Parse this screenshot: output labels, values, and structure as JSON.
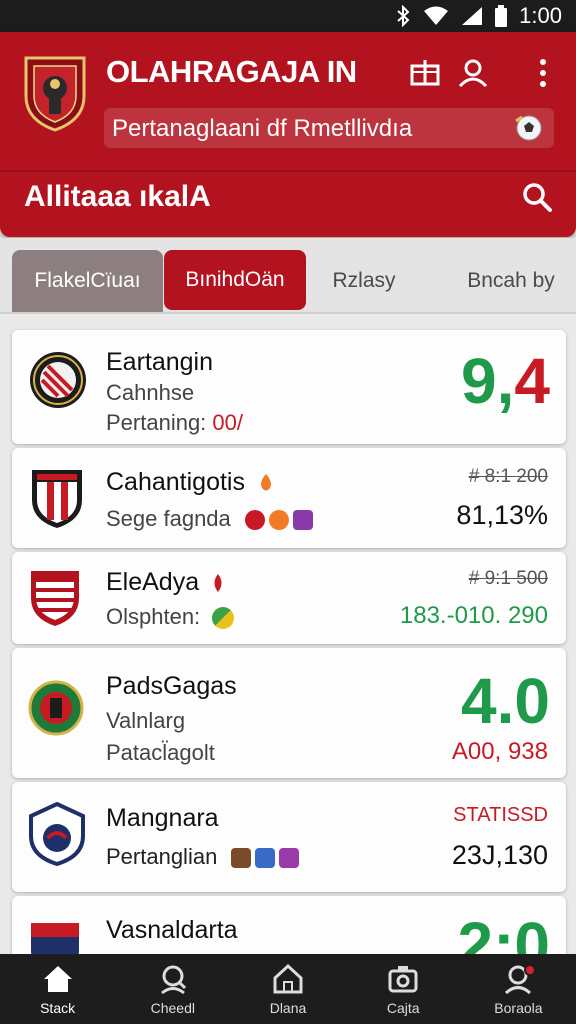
{
  "status_bar": {
    "time": "1:00"
  },
  "header": {
    "title": "OLAHRAGAJA IN",
    "subtitle": "Pertanaglaani df Rmetllivdıa",
    "section_title": "Allitaaa ıkalA"
  },
  "tabs": [
    {
      "label": "FlakelCïuaı"
    },
    {
      "label": "BınihdOän"
    },
    {
      "label": "Rzlasy"
    },
    {
      "label": "Bncah by"
    }
  ],
  "items": [
    {
      "name": "Eartangin",
      "line2": "Cahnhse",
      "line3_label": "Pertaning:",
      "line3_value": "00/",
      "value": "9,4",
      "value_colors": [
        "#1f9a4a",
        "#c81a24"
      ]
    },
    {
      "name": "Cahantigotis",
      "line2": "Sege fagnda",
      "old_value": "# 8:1 200",
      "value": "81,13%"
    },
    {
      "name": "EleAdya",
      "line2": "Olsphten:",
      "old_value": "# 9:1 500",
      "value": "183.-010. 290"
    },
    {
      "name": "PadsGagas",
      "line2": "Valnlarg",
      "line3": "Patacl̈agolt",
      "value": "4.0",
      "sub_value": "A00, 938"
    },
    {
      "name": "Mangnara",
      "line2": "Pertanglian",
      "status": "STATISSD",
      "value": "23J,130"
    },
    {
      "name": "Vasnaldarta",
      "value": "2:0"
    }
  ],
  "bottom_nav": [
    {
      "label": "Stack",
      "icon": "home-icon"
    },
    {
      "label": "Cheedl",
      "icon": "search-person-icon"
    },
    {
      "label": "Dlana",
      "icon": "house-outline-icon"
    },
    {
      "label": "Cajta",
      "icon": "camera-icon"
    },
    {
      "label": "Boraola",
      "icon": "profile-icon"
    }
  ]
}
